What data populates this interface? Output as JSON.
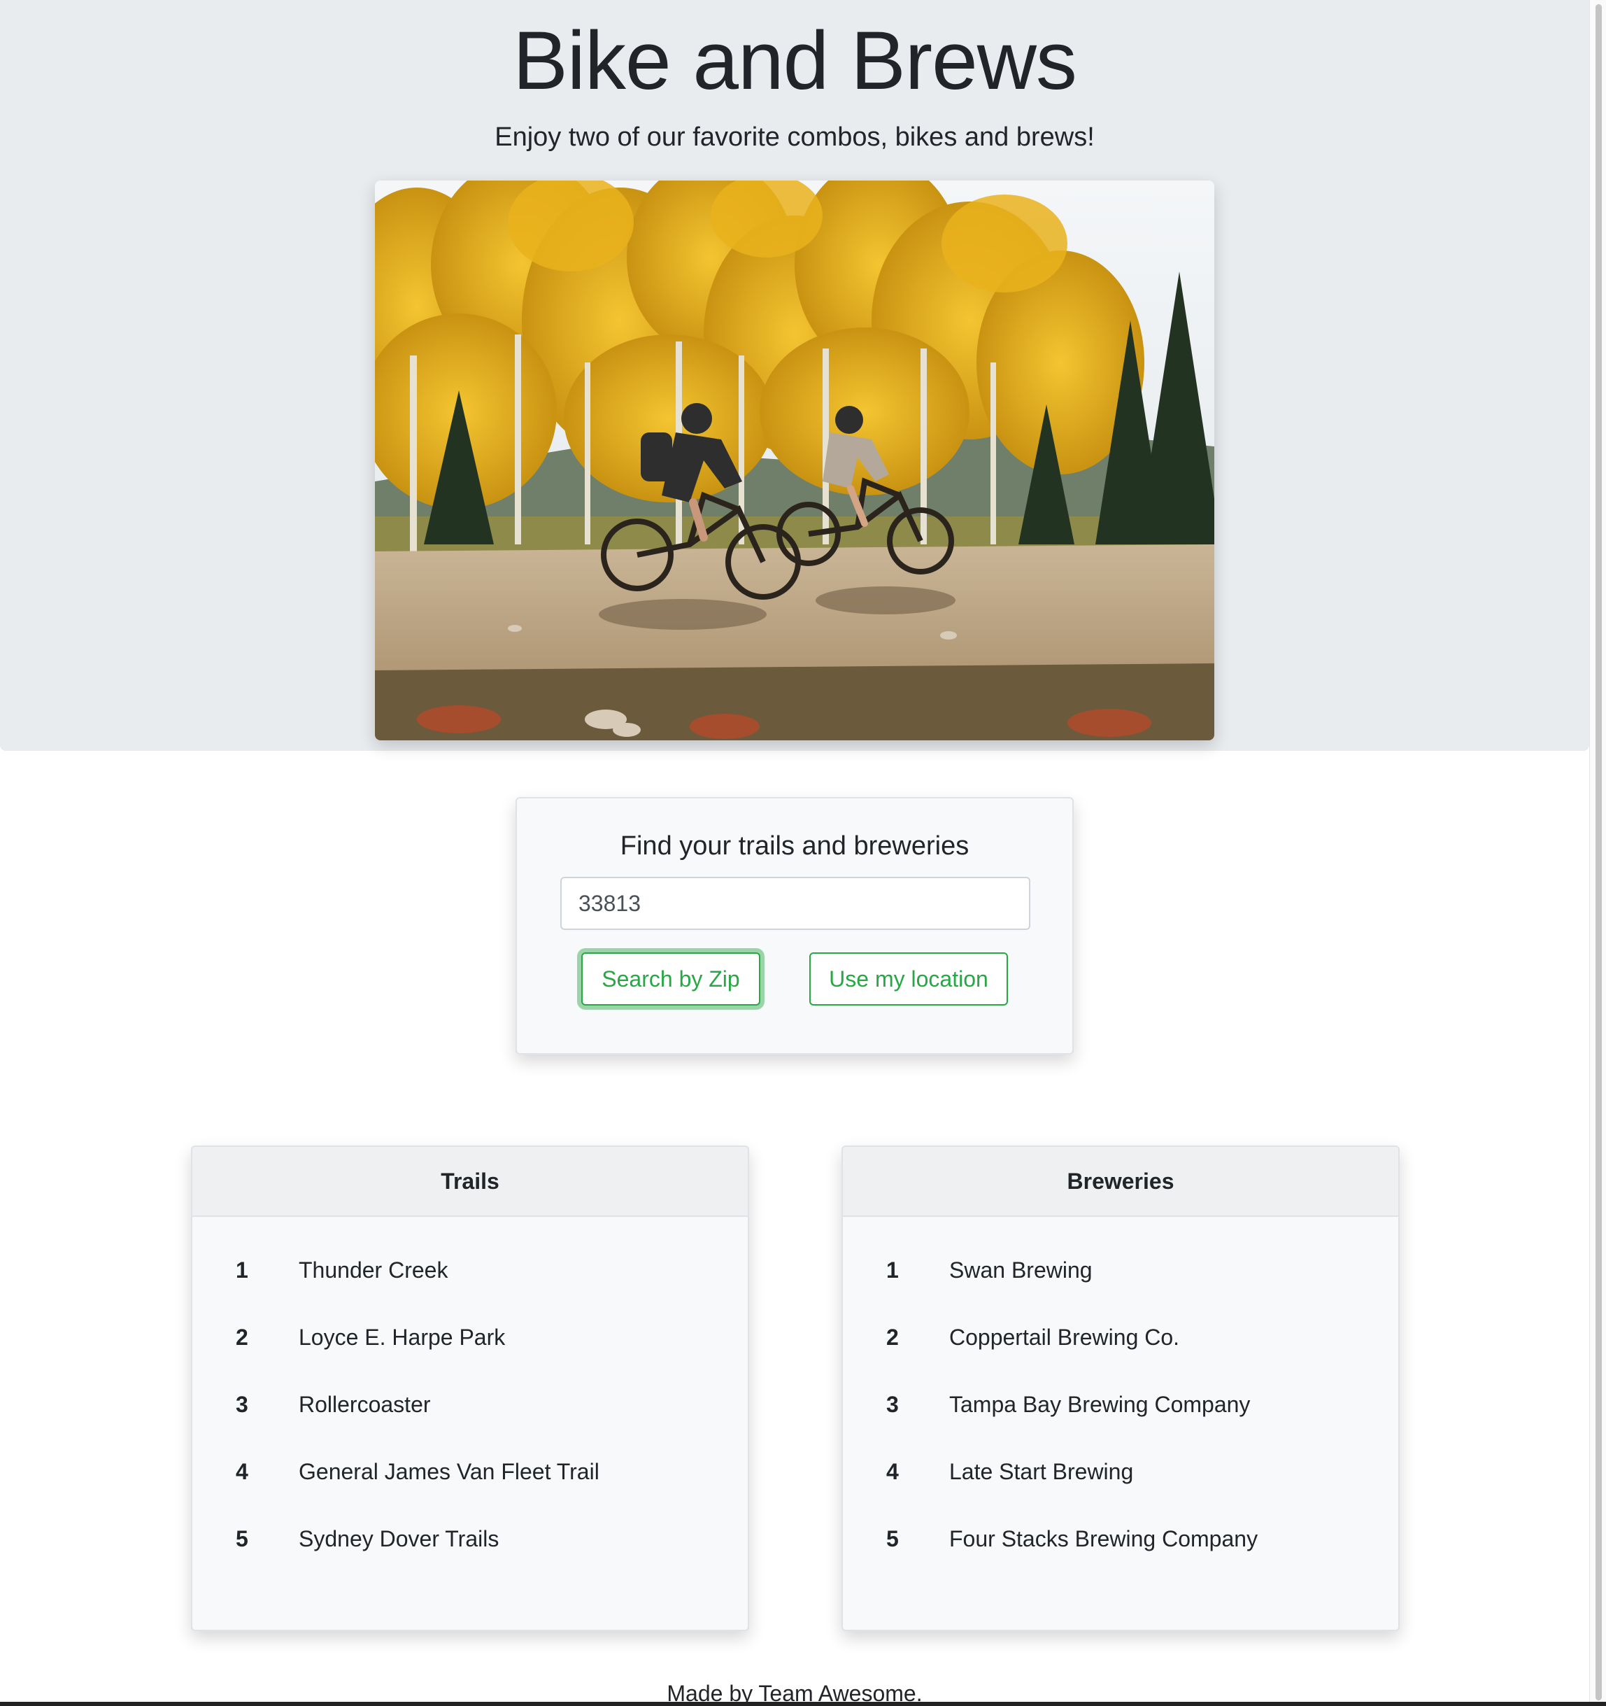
{
  "hero": {
    "title": "Bike and Brews",
    "subtitle": "Enjoy two of our favorite combos, bikes and brews!"
  },
  "search": {
    "heading": "Find your trails and breweries",
    "zip_value": "33813",
    "search_zip_label": "Search by Zip",
    "use_location_label": "Use my location"
  },
  "trails": {
    "header": "Trails",
    "items": [
      {
        "rank": "1",
        "name": "Thunder Creek"
      },
      {
        "rank": "2",
        "name": "Loyce E. Harpe Park"
      },
      {
        "rank": "3",
        "name": "Rollercoaster"
      },
      {
        "rank": "4",
        "name": "General James Van Fleet Trail"
      },
      {
        "rank": "5",
        "name": "Sydney Dover Trails"
      }
    ]
  },
  "breweries": {
    "header": "Breweries",
    "items": [
      {
        "rank": "1",
        "name": "Swan Brewing"
      },
      {
        "rank": "2",
        "name": "Coppertail Brewing Co."
      },
      {
        "rank": "3",
        "name": "Tampa Bay Brewing Company"
      },
      {
        "rank": "4",
        "name": "Late Start Brewing"
      },
      {
        "rank": "5",
        "name": "Four Stacks Brewing Company"
      }
    ]
  },
  "footer": {
    "text": "Made by Team Awesome."
  },
  "colors": {
    "hero_bg": "#e9ecef",
    "accent_green": "#28a745",
    "card_bg": "#f8f9fa"
  }
}
